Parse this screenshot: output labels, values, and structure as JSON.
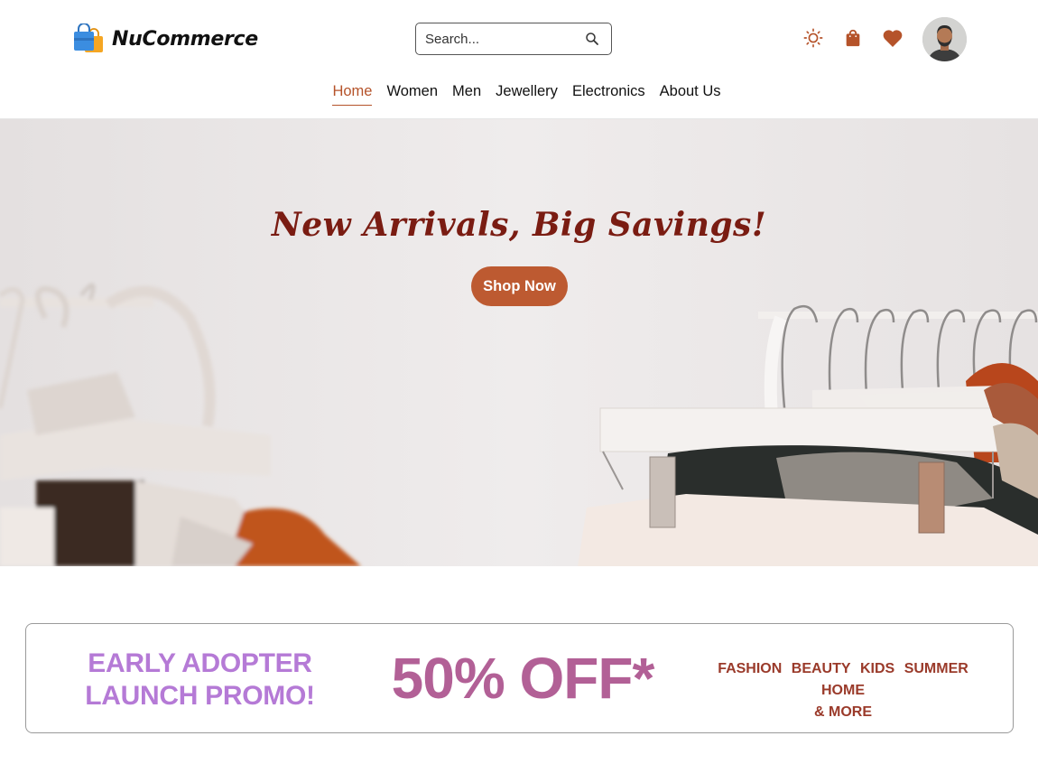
{
  "brand": {
    "name": "NuCommerce"
  },
  "search": {
    "placeholder": "Search..."
  },
  "header_icons": {
    "theme": "sun-icon",
    "cart": "shopping-bag-icon",
    "wishlist": "heart-icon",
    "accent": "#b5532a"
  },
  "nav": {
    "items": [
      {
        "label": "Home",
        "active": true
      },
      {
        "label": "Women"
      },
      {
        "label": "Men"
      },
      {
        "label": "Jewellery"
      },
      {
        "label": "Electronics"
      },
      {
        "label": "About Us"
      }
    ]
  },
  "hero": {
    "title": "New Arrivals, Big Savings!",
    "cta_label": "Shop Now",
    "title_color": "#7a1c12",
    "cta_color": "#bd5a31"
  },
  "promo": {
    "line1": "EARLY ADOPTER",
    "line2": "LAUNCH PROMO!",
    "discount": "50% OFF*",
    "categories": [
      "FASHION",
      "BEAUTY",
      "KIDS",
      "SUMMER",
      "HOME"
    ],
    "more": "& MORE"
  }
}
